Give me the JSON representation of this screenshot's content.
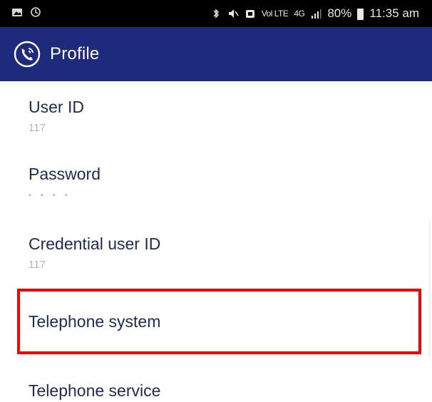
{
  "status_bar": {
    "left_icons": [
      "image-icon",
      "sync-icon"
    ],
    "signal_text": "4G",
    "volte_text": "Vol LTE",
    "battery_percent": "80%",
    "time": "11:35 am"
  },
  "app_bar": {
    "title": "Profile",
    "colors": {
      "background": "#1e2a7c",
      "text": "#ffffff"
    }
  },
  "preferences": [
    {
      "title": "User ID",
      "summary": "117"
    },
    {
      "title": "Password",
      "summary": "• • • •"
    },
    {
      "title": "Credential user ID",
      "summary": "117"
    },
    {
      "title": "Telephone system",
      "summary": ""
    },
    {
      "title": "Telephone service",
      "summary": ""
    }
  ],
  "highlight": {
    "target": "Telephone system",
    "color": "#ff0000"
  }
}
